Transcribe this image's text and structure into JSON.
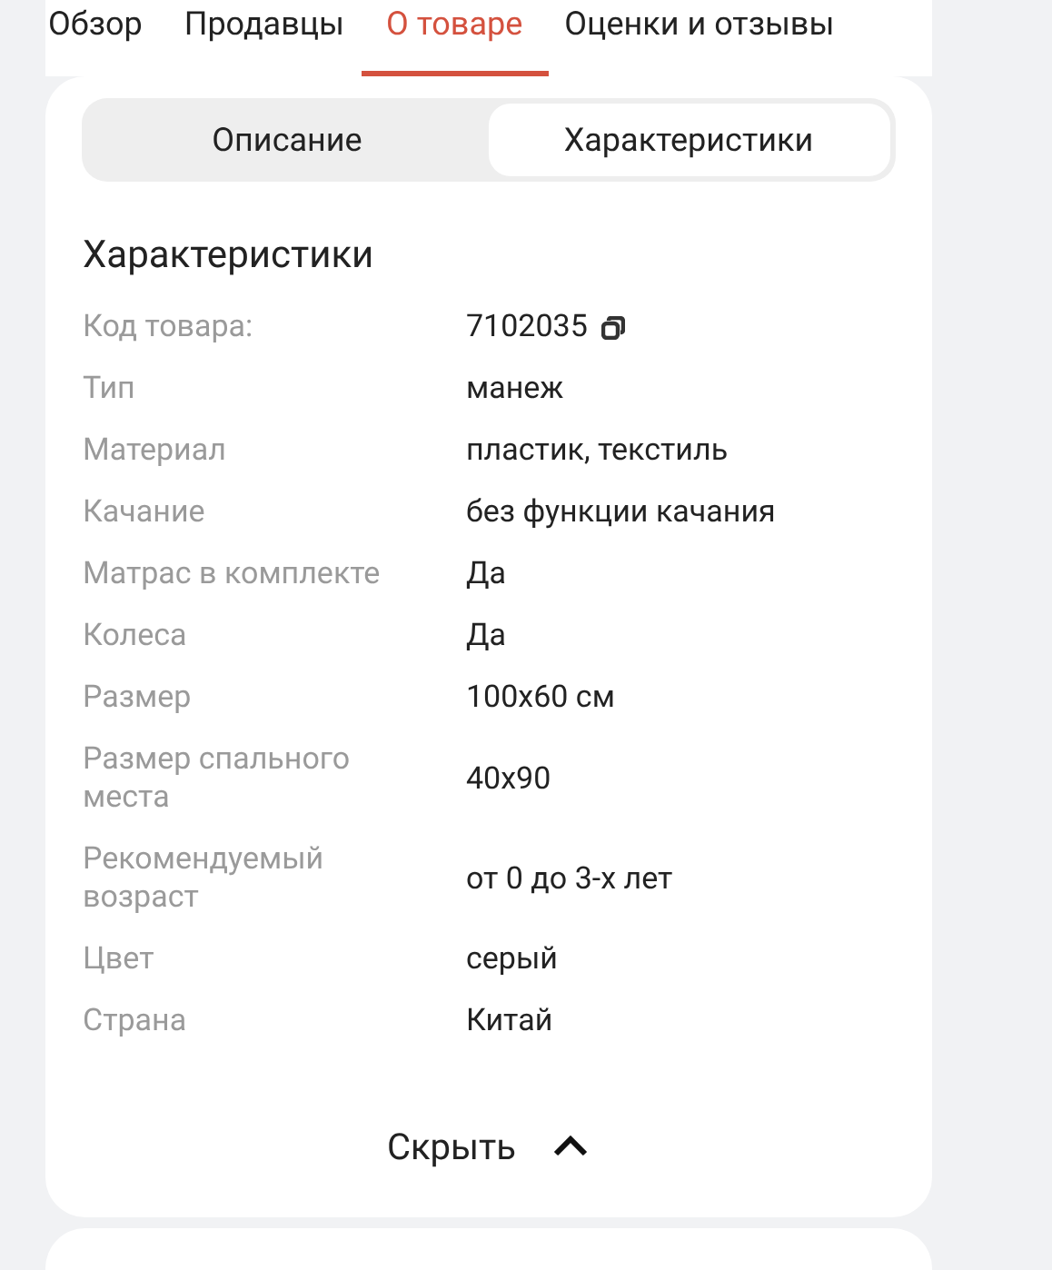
{
  "tabs": [
    {
      "label": "Обзор",
      "selected": false
    },
    {
      "label": "Продавцы",
      "selected": false
    },
    {
      "label": "О товаре",
      "selected": true
    },
    {
      "label": "Оценки и отзывы",
      "selected": false
    }
  ],
  "segments": [
    {
      "label": "Описание",
      "selected": false
    },
    {
      "label": "Характеристики",
      "selected": true
    }
  ],
  "specs": {
    "title": "Характеристики",
    "rows": [
      {
        "name": "Код товара:",
        "value": "7102035",
        "copyable": true
      },
      {
        "name": "Тип",
        "value": "манеж",
        "copyable": false
      },
      {
        "name": "Материал",
        "value": "пластик, текстиль",
        "copyable": false
      },
      {
        "name": "Качание",
        "value": "без функции качания",
        "copyable": false
      },
      {
        "name": "Матрас в комплекте",
        "value": "Да",
        "copyable": false
      },
      {
        "name": "Колеса",
        "value": "Да",
        "copyable": false
      },
      {
        "name": "Размер",
        "value": "100x60 см",
        "copyable": false
      },
      {
        "name": "Размер спального места",
        "value": "40x90",
        "copyable": false
      },
      {
        "name": "Рекомендуемый возраст",
        "value": "от 0 до 3-х лет",
        "copyable": false
      },
      {
        "name": "Цвет",
        "value": "серый",
        "copyable": false
      },
      {
        "name": "Страна",
        "value": "Китай",
        "copyable": false
      }
    ]
  },
  "collapse_button": {
    "label": "Скрыть",
    "expanded": true
  }
}
